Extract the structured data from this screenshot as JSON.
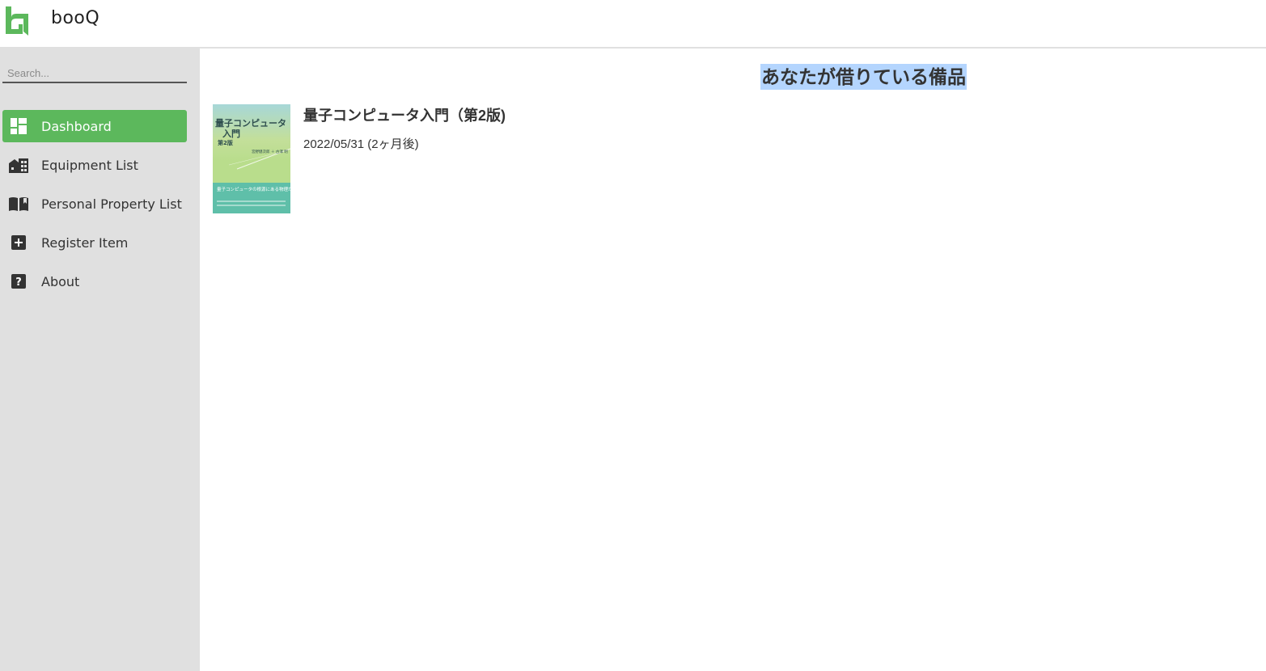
{
  "app": {
    "name": "booQ",
    "brand_color": "#5cb85c"
  },
  "search": {
    "placeholder": "Search...",
    "value": ""
  },
  "sidebar": {
    "items": [
      {
        "label": "Dashboard",
        "icon": "dashboard-icon",
        "active": true
      },
      {
        "label": "Equipment List",
        "icon": "domain-icon",
        "active": false
      },
      {
        "label": "Personal Property List",
        "icon": "book-open-icon",
        "active": false
      },
      {
        "label": "Register Item",
        "icon": "add-box-icon",
        "active": false
      },
      {
        "label": "About",
        "icon": "help-icon",
        "active": false
      }
    ]
  },
  "main": {
    "title": "あなたが借りている備品",
    "items": [
      {
        "title": "量子コンピュータ入門（第2版)",
        "due": "2022/05/31 (2ヶ月後)",
        "cover": {
          "title_line1": "量子コンピュータ",
          "title_line2": "入門",
          "edition": "第2版",
          "author": "宮野健次郎 ＋ 古澤 明",
          "tagline": "量子コンピュータの根源にある物理がわかる"
        }
      }
    ]
  }
}
